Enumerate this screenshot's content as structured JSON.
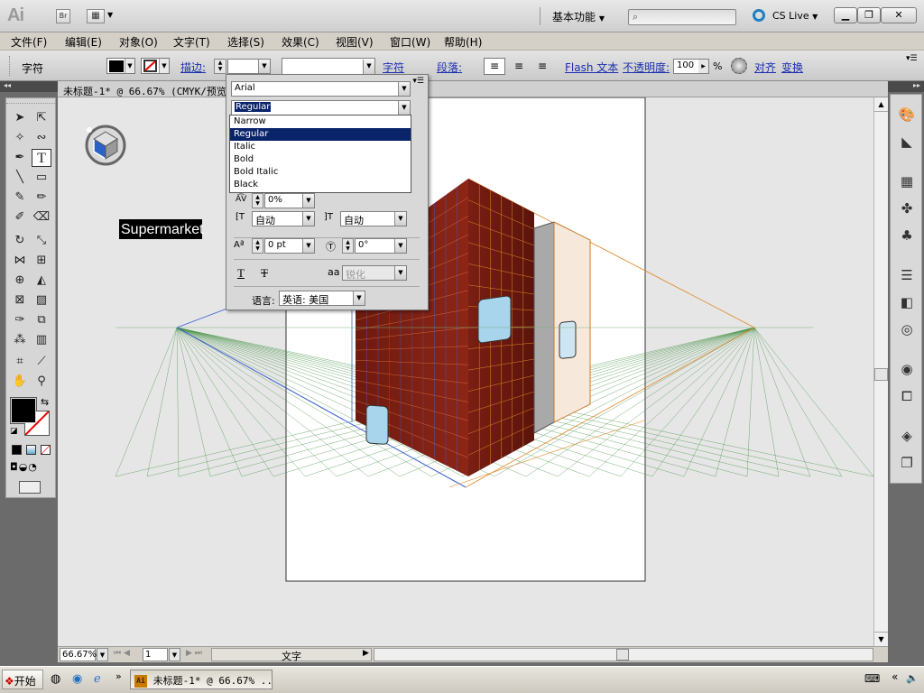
{
  "app": {
    "logo": "Ai",
    "bridge": "Br",
    "workspace": "基本功能",
    "cslive": "CS Live"
  },
  "winbtns": [
    "▁",
    "❐",
    "✕"
  ],
  "menus": [
    "文件(F)",
    "编辑(E)",
    "对象(O)",
    "文字(T)",
    "选择(S)",
    "效果(C)",
    "视图(V)",
    "窗口(W)",
    "帮助(H)"
  ],
  "control": {
    "mode": "字符",
    "stroke_label": "描边:",
    "char_link": "字符",
    "para_link": "段落:",
    "flash_link": "Flash 文本",
    "opacity_label": "不透明度:",
    "opacity_value": "100",
    "percent": "%",
    "align_link": "对齐",
    "transform_link": "变换"
  },
  "document": {
    "tab_title": "未标题-1* @ 66.67% (CMYK/预览)"
  },
  "canvas": {
    "text_label": "Supermarket"
  },
  "charpanel": {
    "font_family": "Arial",
    "font_style": "Regular",
    "style_options": [
      "Narrow",
      "Regular",
      "Italic",
      "Bold",
      "Bold Italic",
      "Black"
    ],
    "selected_index": 1,
    "tracking_value": "0%",
    "auto1": "自动",
    "auto2": "自动",
    "baseline_value": "0 pt",
    "rotation_value": "0°",
    "antialias_value": "锐化",
    "language_label": "语言:",
    "language_value": "英语: 美国"
  },
  "status": {
    "zoom": "66.67%",
    "page": "1",
    "tool": "文字"
  },
  "taskbar": {
    "start": "开始",
    "task": "未标题-1* @ 66.67% ..."
  },
  "colors": {
    "building": "#7b1f12",
    "grid_orange": "#e08a2a",
    "grid_blue": "#3a5fd0",
    "grid_green": "#3c8c3c",
    "selection": "#0a246a"
  }
}
